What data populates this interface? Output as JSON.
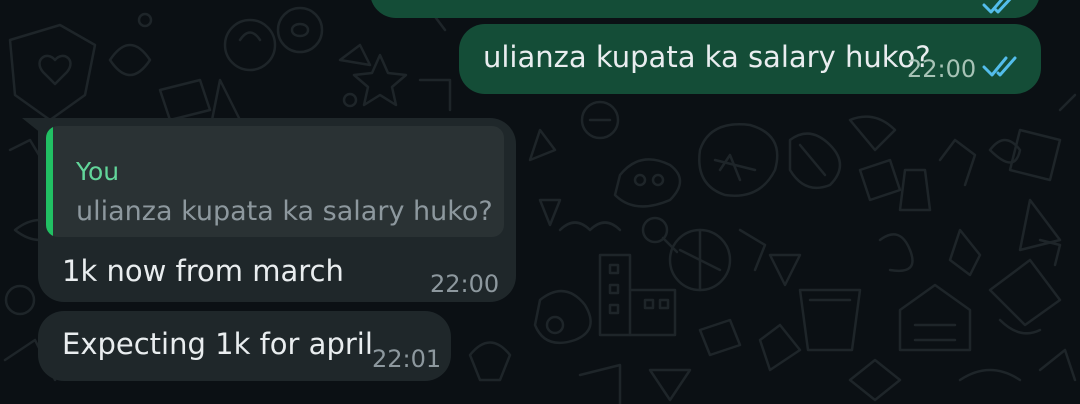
{
  "messages": [
    {
      "direction": "outgoing",
      "text": "",
      "time": "",
      "status": "read",
      "status_icon": "double-check-icon"
    },
    {
      "direction": "outgoing",
      "text": "ulianza kupata ka salary huko?",
      "time": "22:00",
      "status": "read",
      "status_icon": "double-check-icon"
    },
    {
      "direction": "incoming",
      "quote": {
        "author": "You",
        "text": "ulianza kupata ka salary huko?"
      },
      "text": "1k now from march",
      "time": "22:00"
    },
    {
      "direction": "incoming",
      "text": "Expecting 1k for april",
      "time": "22:01"
    }
  ],
  "colors": {
    "background": "#0b1014",
    "outgoing_bubble": "#144d37",
    "incoming_bubble": "#1f272a",
    "quote_bar": "#21c063",
    "read_ticks": "#53bdeb"
  }
}
